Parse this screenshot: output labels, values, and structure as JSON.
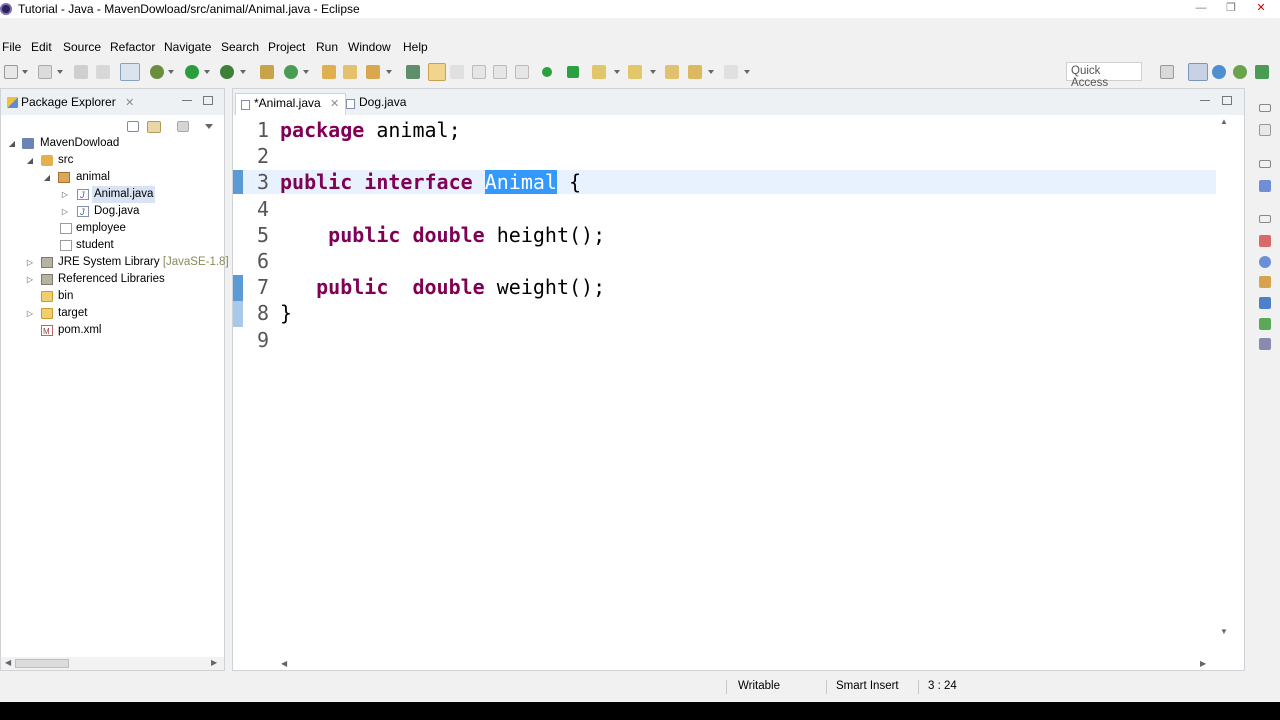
{
  "window": {
    "title": "Tutorial - Java - MavenDowload/src/animal/Animal.java - Eclipse"
  },
  "menubar": {
    "items": [
      "File",
      "Edit",
      "Source",
      "Refactor",
      "Navigate",
      "Search",
      "Project",
      "Run",
      "Window",
      "Help"
    ]
  },
  "toolbar": {
    "quick_access_label": "Quick Access"
  },
  "package_explorer": {
    "title": "Package Explorer",
    "tree": [
      {
        "label": "MavenDowload",
        "icon": "project-icon",
        "expanded": true
      },
      {
        "label": "src",
        "icon": "source-folder-icon",
        "expanded": true
      },
      {
        "label": "animal",
        "icon": "package-icon",
        "expanded": true
      },
      {
        "label": "Animal.java",
        "icon": "java-file-icon",
        "selected": true
      },
      {
        "label": "Dog.java",
        "icon": "java-file-icon"
      },
      {
        "label": "employee",
        "icon": "empty-package-icon"
      },
      {
        "label": "student",
        "icon": "empty-package-icon"
      },
      {
        "label": "JRE System Library",
        "suffix": "[JavaSE-1.8]",
        "icon": "library-icon"
      },
      {
        "label": "Referenced Libraries",
        "icon": "library-icon"
      },
      {
        "label": "bin",
        "icon": "folder-icon"
      },
      {
        "label": "target",
        "icon": "folder-icon"
      },
      {
        "label": "pom.xml",
        "icon": "maven-xml-icon"
      }
    ]
  },
  "editor": {
    "tabs": [
      {
        "label": "*Animal.java",
        "active": true
      },
      {
        "label": "Dog.java",
        "active": false
      }
    ],
    "lines": [
      {
        "num": "1",
        "parts": [
          {
            "t": "package",
            "kw": true
          },
          {
            "t": " animal;"
          }
        ]
      },
      {
        "num": "2",
        "parts": []
      },
      {
        "num": "3",
        "parts": [
          {
            "t": "public",
            "kw": true
          },
          {
            "t": " "
          },
          {
            "t": "interface",
            "kw": true
          },
          {
            "t": " "
          },
          {
            "t": "Animal",
            "sel": true
          },
          {
            "t": " {"
          }
        ]
      },
      {
        "num": "4",
        "parts": []
      },
      {
        "num": "5",
        "parts": [
          {
            "t": "    "
          },
          {
            "t": "public",
            "kw": true
          },
          {
            "t": " "
          },
          {
            "t": "double",
            "kw": true
          },
          {
            "t": " height();"
          }
        ]
      },
      {
        "num": "6",
        "parts": []
      },
      {
        "num": "7",
        "parts": [
          {
            "t": "   "
          },
          {
            "t": "public",
            "kw": true
          },
          {
            "t": "  "
          },
          {
            "t": "double",
            "kw": true
          },
          {
            "t": " weight();"
          }
        ]
      },
      {
        "num": "8",
        "parts": [
          {
            "t": "}"
          }
        ]
      },
      {
        "num": "9",
        "parts": []
      }
    ]
  },
  "statusbar": {
    "writable": "Writable",
    "insert_mode": "Smart Insert",
    "position": "3 : 24"
  }
}
